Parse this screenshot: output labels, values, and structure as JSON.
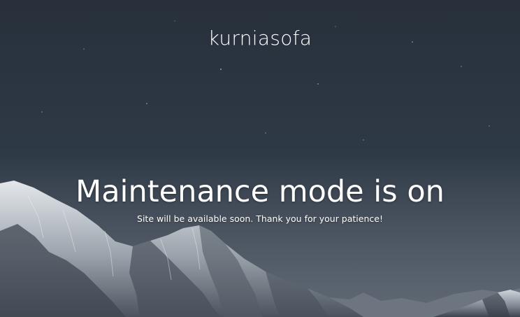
{
  "site": {
    "title": "kurniasofa"
  },
  "maintenance": {
    "headline": "Maintenance mode is on",
    "message": "Site will be available soon. Thank you for your patience!"
  },
  "background": {
    "scene": "night-sky-mountains-image",
    "sky_color": "#2c3440",
    "snow_color": "#d8dde2"
  }
}
